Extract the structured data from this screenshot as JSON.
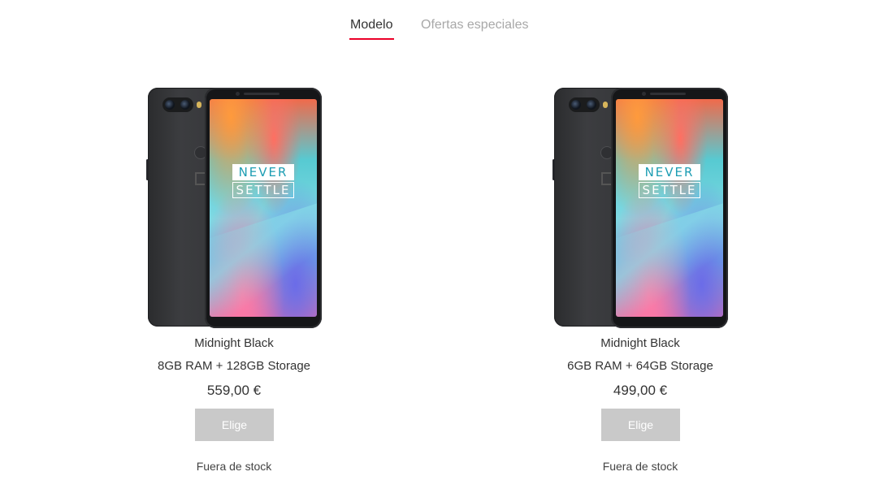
{
  "tabs": {
    "model": "Modelo",
    "offers": "Ofertas especiales"
  },
  "accent_color": "#eb0028",
  "products": [
    {
      "color_name": "Midnight Black",
      "storage": "8GB RAM + 128GB Storage",
      "price": "559,00 €",
      "button_label": "Elige",
      "stock_status": "Fuera de stock",
      "screen_text": [
        "NEVER",
        "SETTLE"
      ]
    },
    {
      "color_name": "Midnight Black",
      "storage": "6GB RAM + 64GB Storage",
      "price": "499,00 €",
      "button_label": "Elige",
      "stock_status": "Fuera de stock",
      "screen_text": [
        "NEVER",
        "SETTLE"
      ]
    }
  ]
}
